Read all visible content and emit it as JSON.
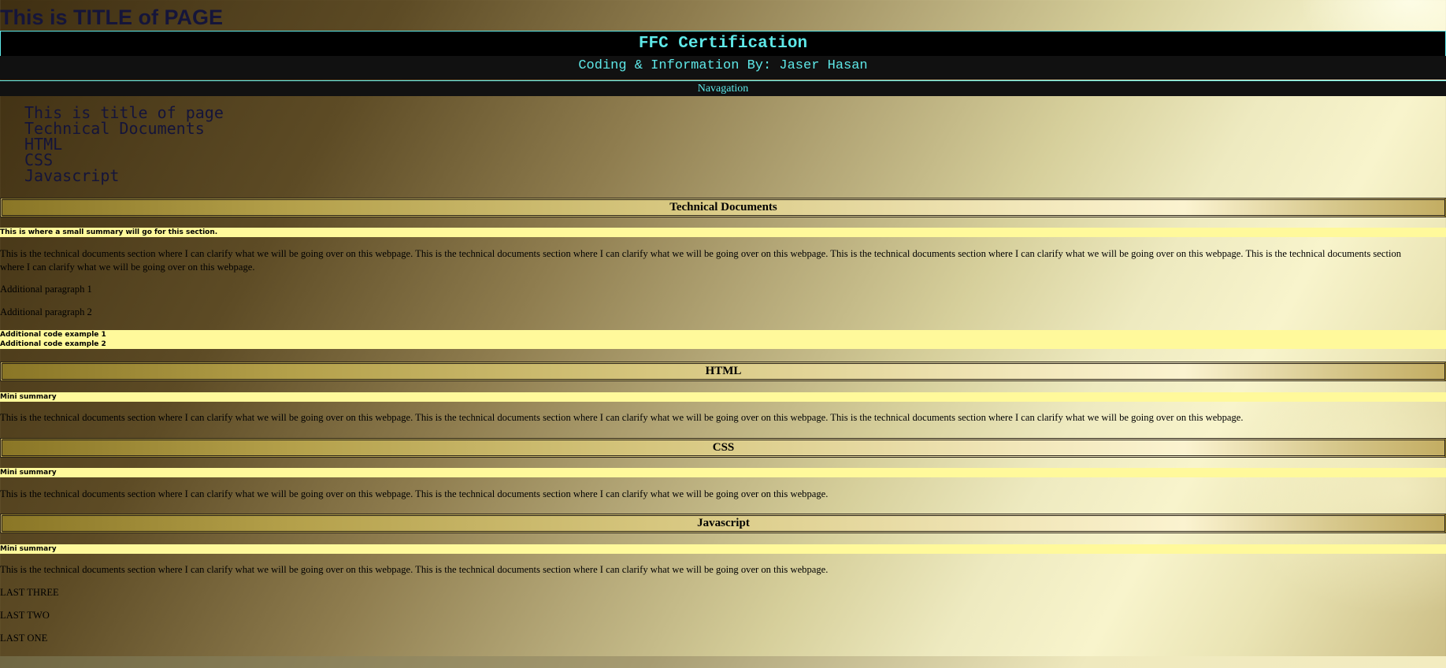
{
  "page": {
    "title": "This is TITLE of PAGE"
  },
  "header": {
    "certification": "FFC Certification",
    "author": "Coding & Information By: Jaser Hasan",
    "nav_label": "Navagation"
  },
  "nav": {
    "items": [
      "This is title of page",
      "Technical Documents",
      "HTML",
      "CSS",
      "Javascript"
    ]
  },
  "sections": {
    "technical": {
      "heading": "Technical Documents",
      "summary": "This is where a small summary will go for this section.",
      "body": "This is the technical documents section where I can clarify what we will be going over on this webpage. This is the technical documents section where I can clarify what we will be going over on this webpage. This is the technical documents section where I can clarify what we will be going over on this webpage. This is the technical documents section where I can clarify what we will be going over on this webpage.",
      "para1": "Additional paragraph 1",
      "para2": "Additional paragraph 2",
      "code1": "Additional code example 1",
      "code2": "Additional code example 2"
    },
    "html": {
      "heading": "HTML",
      "summary": "Mini summary",
      "body": "This is the technical documents section where I can clarify what we will be going over on this webpage. This is the technical documents section where I can clarify what we will be going over on this webpage. This is the technical documents section where I can clarify what we will be going over on this webpage."
    },
    "css": {
      "heading": "CSS",
      "summary": "Mini summary",
      "body": "This is the technical documents section where I can clarify what we will be going over on this webpage. This is the technical documents section where I can clarify what we will be going over on this webpage."
    },
    "javascript": {
      "heading": "Javascript",
      "summary": "Mini summary",
      "body": "This is the technical documents section where I can clarify what we will be going over on this webpage. This is the technical documents section where I can clarify what we will be going over on this webpage.",
      "last_three": "LAST THREE",
      "last_two": "LAST TWO",
      "last_one": "LAST ONE"
    }
  },
  "colors": {
    "accent_cyan": "#5ee8e8",
    "header_black": "#000000",
    "summary_yellow": "#fff99b",
    "title_navy": "#15153a"
  }
}
